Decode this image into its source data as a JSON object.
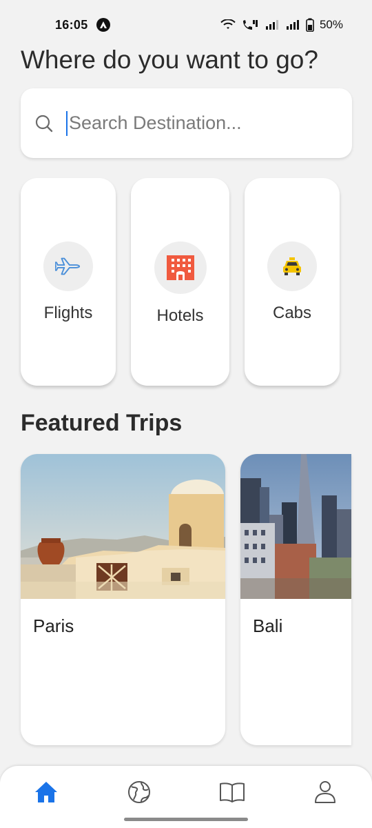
{
  "status_bar": {
    "time": "16:05",
    "battery": "50%",
    "icons": [
      "app-badge-icon",
      "wifi-icon",
      "wifi-call-icon",
      "signal-icon",
      "signal-icon",
      "battery-icon"
    ]
  },
  "heading": "Where do you want to go?",
  "search": {
    "placeholder": "Search Destination...",
    "value": "",
    "icon": "search-icon"
  },
  "categories": [
    {
      "label": "Flights",
      "icon": "airplane-icon",
      "color": "#4a8fd9"
    },
    {
      "label": "Hotels",
      "icon": "hotel-icon",
      "color": "#f05a3f"
    },
    {
      "label": "Cabs",
      "icon": "taxi-icon",
      "color": "#f5c400"
    }
  ],
  "featured": {
    "title": "Featured Trips",
    "trips": [
      {
        "name": "Paris",
        "image": "santorini-landscape"
      },
      {
        "name": "Bali",
        "image": "city-skyline"
      }
    ]
  },
  "bottom_nav": {
    "items": [
      {
        "name": "home",
        "icon": "home-icon",
        "active": true
      },
      {
        "name": "explore",
        "icon": "globe-icon",
        "active": false
      },
      {
        "name": "guides",
        "icon": "book-icon",
        "active": false
      },
      {
        "name": "profile",
        "icon": "person-icon",
        "active": false
      }
    ],
    "active_color": "#1a73e8",
    "inactive_color": "#555555"
  }
}
